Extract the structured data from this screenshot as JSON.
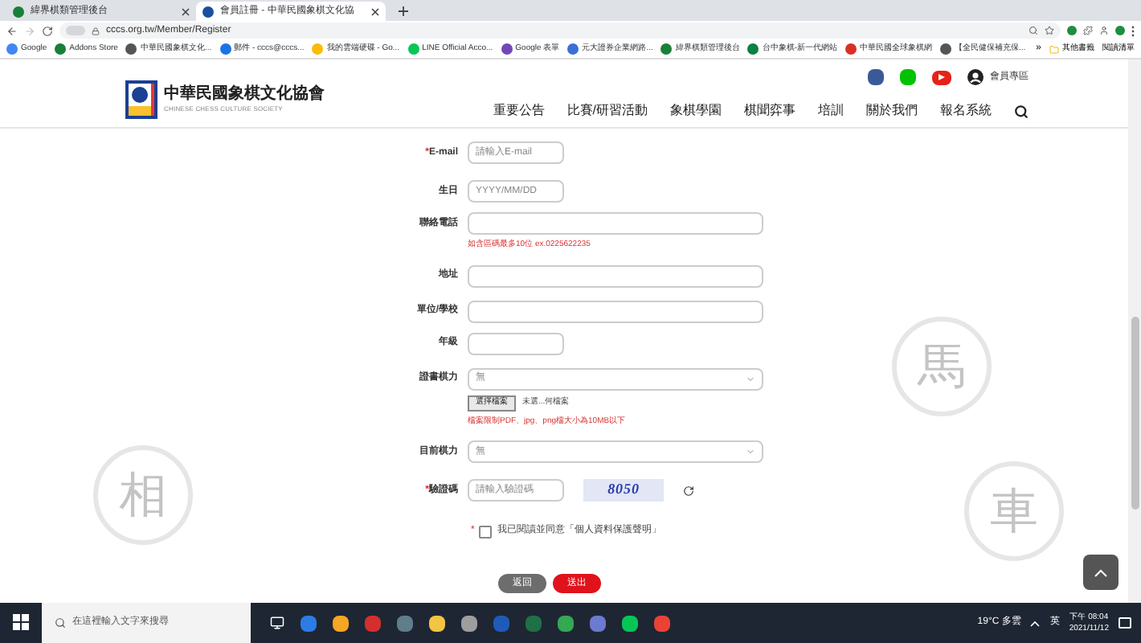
{
  "browser": {
    "tabs": [
      {
        "title": "緯界棋類管理後台",
        "selected": false
      },
      {
        "title": "會員註冊 - 中華民國象棋文化協",
        "selected": true
      }
    ],
    "address": "cccs.org.tw/Member/Register",
    "bookmarks": [
      "Google",
      "Addons Store",
      "中華民國象棋文化...",
      "郵件 - cccs@cccs...",
      "我的雲端硬碟 - Go...",
      "LINE Official Acco...",
      "Google 表單",
      "元大證券企業網路...",
      "緯界棋類管理後台",
      "台中象棋-新一代網站",
      "中華民國全球象棋網",
      "【全民健保補充保..."
    ],
    "bookmarks_more": "»",
    "other_bookmarks": "其他書籤",
    "reading_list": "閱讀清單"
  },
  "site": {
    "name": "中華民國象棋文化協會",
    "name_en": "CHINESE CHESS CULTURE SOCIETY",
    "member_link": "會員專區",
    "nav": [
      "重要公告",
      "比賽/研習活動",
      "象棋學園",
      "棋聞弈事",
      "培訓",
      "關於我們",
      "報名系統"
    ]
  },
  "background_pieces": [
    "相",
    "馬",
    "車"
  ],
  "form": {
    "required_mark": "*",
    "fields": [
      {
        "kind": "short",
        "label": "E-mail",
        "required": true,
        "placeholder": "請輸入E-mail"
      },
      {
        "kind": "short",
        "label": "生日",
        "required": false,
        "placeholder": "YYYY/MM/DD"
      },
      {
        "kind": "wide",
        "label": "聯絡電話",
        "required": false,
        "hint": "如含區碼最多10位 ex.0225622235"
      },
      {
        "kind": "wide",
        "label": "地址",
        "required": false
      },
      {
        "kind": "wide",
        "label": "單位/學校",
        "required": false
      },
      {
        "kind": "short",
        "label": "年級",
        "required": false
      },
      {
        "kind": "select",
        "label": "證書棋力",
        "required": false,
        "value": "無",
        "file_button": "選擇檔案",
        "file_status": "未選...何檔案",
        "hint": "檔案限制PDF、jpg、png檔大小為10MB以下"
      },
      {
        "kind": "select",
        "label": "目前棋力",
        "required": false,
        "value": "無"
      },
      {
        "kind": "captcha",
        "label": "驗證碼",
        "required": true,
        "placeholder": "請輸入驗證碼",
        "code": "8050"
      }
    ],
    "agreement": {
      "required": true,
      "checked": false,
      "text": "我已閱讀並同意「個人資料保護聲明」"
    },
    "buttons": [
      {
        "kind": "back",
        "label": "返回"
      },
      {
        "kind": "submit",
        "label": "送出"
      }
    ]
  },
  "taskbar": {
    "search_placeholder": "在這裡輸入文字來搜尋",
    "weather": "19°C 多雲",
    "ime": "英",
    "time": "下午 08:04",
    "date": "2021/11/12"
  }
}
